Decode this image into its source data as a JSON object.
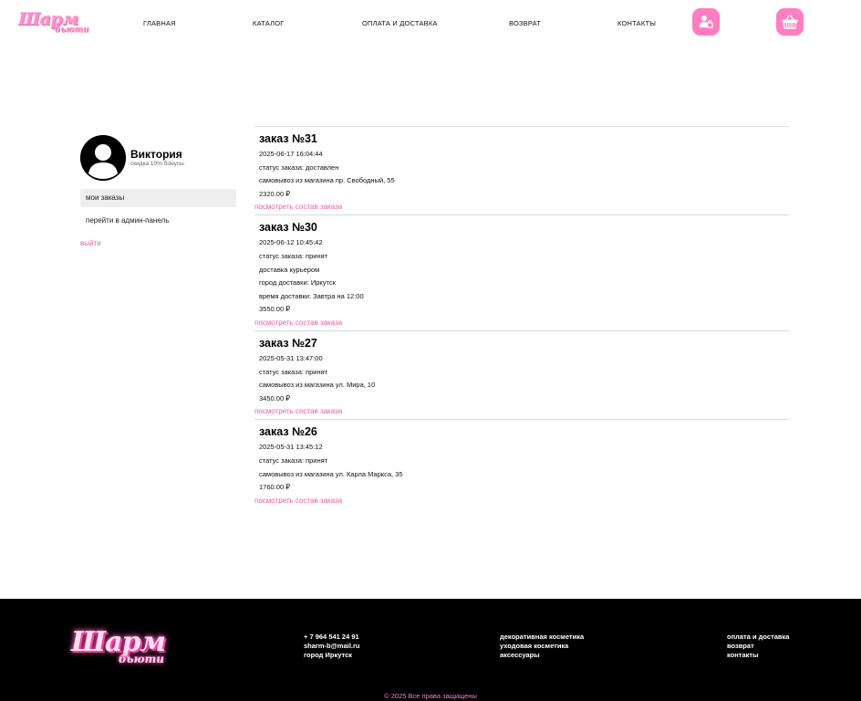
{
  "header": {
    "logo_main": "Шарм",
    "logo_sub": "бьюти",
    "nav": [
      {
        "label": "ГЛАВНАЯ"
      },
      {
        "label": "КАТАЛОГ"
      },
      {
        "label": "ОПЛАТА И ДОСТАВКА"
      },
      {
        "label": "ВОЗВРАТ"
      },
      {
        "label": "КОНТАКТЫ"
      }
    ],
    "icons": {
      "profile": "user-profile-icon",
      "cart": "shopping-basket-icon"
    },
    "accent_color": "#ff7ec0"
  },
  "profile": {
    "name": "Виктория",
    "discount": "скидка 10% бонусы",
    "menu": [
      {
        "label": "мои заказы",
        "active": true
      },
      {
        "label": "перейти в админ-панель",
        "active": false
      }
    ],
    "logout": "выйти"
  },
  "orders": [
    {
      "title": "заказ №31",
      "lines": [
        "2025-06-17 16:04:44",
        "статус заказа: доставлен",
        "самовывоз из магазина пр. Свободный, 55",
        "2320.00 ₽"
      ],
      "link": "посмотреть состав заказа"
    },
    {
      "title": "заказ №30",
      "lines": [
        "2025-06-12 10:45:42",
        "статус заказа: принят",
        "доставка курьером",
        "город доставки: Иркутск",
        "время доставки: Завтра на 12:00",
        "3550.00 ₽"
      ],
      "link": "посмотреть состав заказа"
    },
    {
      "title": "заказ №27",
      "lines": [
        "2025-05-31 13:47:00",
        "статус заказа: принят",
        "самовывоз из магазина ул. Мира, 10",
        "3450.00 ₽"
      ],
      "link": "посмотреть состав заказа"
    },
    {
      "title": "заказ №26",
      "lines": [
        "2025-05-31 13:45:12",
        "статус заказа: принят",
        "самовывоз из магазина ул. Карла Маркса, 35",
        "1760.00 ₽"
      ],
      "link": "посмотреть состав заказа"
    }
  ],
  "footer": {
    "logo_main": "Шарм",
    "logo_sub": "бьюти",
    "contacts": [
      "+ 7 964 541 24 91",
      "sharm-b@mail.ru",
      "город Иркутск"
    ],
    "categories": [
      "декоративная косметика",
      "уходовая косметика",
      "аксессуары"
    ],
    "info": [
      "оплата и доставка",
      "возврат",
      "контакты"
    ],
    "copyright": "© 2025 Все права защищены",
    "background": "#000000",
    "link_color": "#e5609f"
  }
}
